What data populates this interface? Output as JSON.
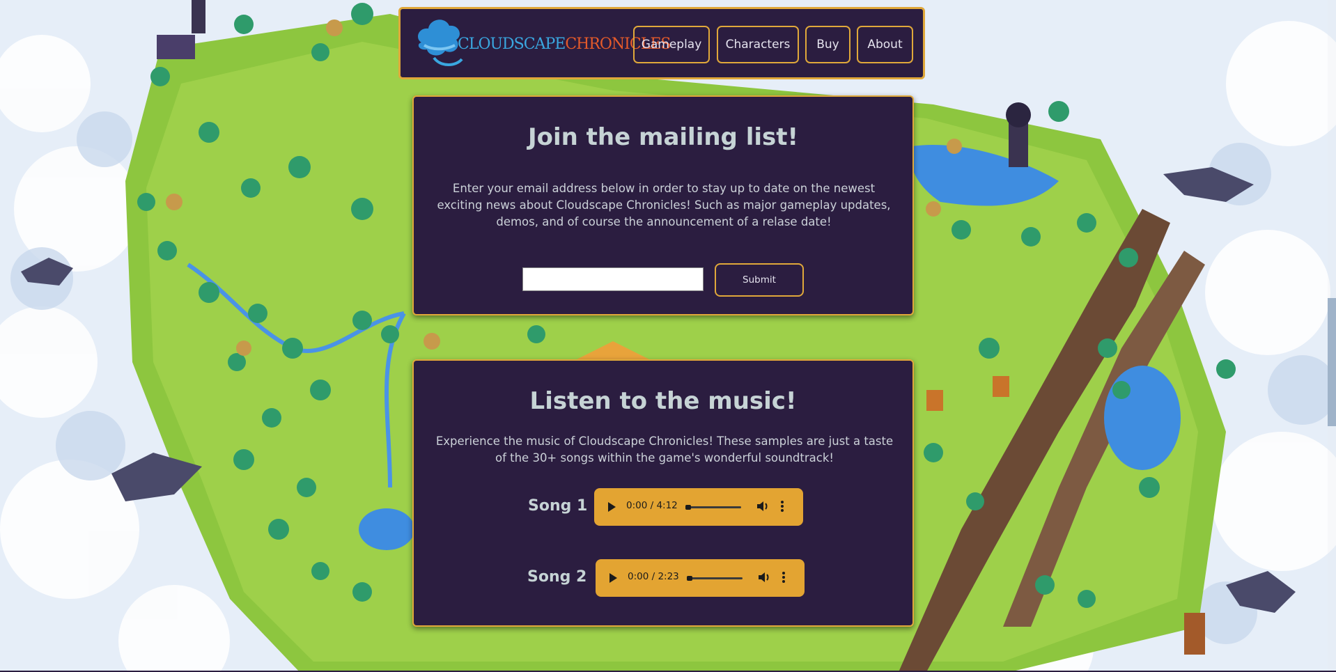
{
  "header": {
    "logo_word_1": "CLOUDSCAPE",
    "logo_word_2": "CHRONICLES",
    "nav": [
      {
        "label": "Gameplay"
      },
      {
        "label": "Characters"
      },
      {
        "label": "Buy"
      },
      {
        "label": "About"
      }
    ]
  },
  "mailing": {
    "title": "Join the mailing list!",
    "text": "Enter your email address below in order to stay up to date on the newest exciting news about Cloudscape Chronicles! Such as major gameplay updates, demos, and of course the announcement of a relase date!",
    "email_value": "",
    "submit_label": "Submit"
  },
  "music": {
    "title": "Listen to the music!",
    "text": "Experience the music of Cloudscape Chronicles! These samples are just a taste of the 30+ songs within the game's wonderful soundtrack!",
    "songs": [
      {
        "label": "Song 1",
        "time": "0:00 / 4:12"
      },
      {
        "label": "Song 2",
        "time": "0:00 / 2:23"
      }
    ]
  },
  "colors": {
    "panel": "#2b1d40",
    "border": "#e0a83a",
    "player": "#e3a432",
    "heading": "#c6d3d5"
  },
  "icons": [
    "logo-cloud-icon",
    "play-icon",
    "volume-icon",
    "more-options-icon"
  ]
}
